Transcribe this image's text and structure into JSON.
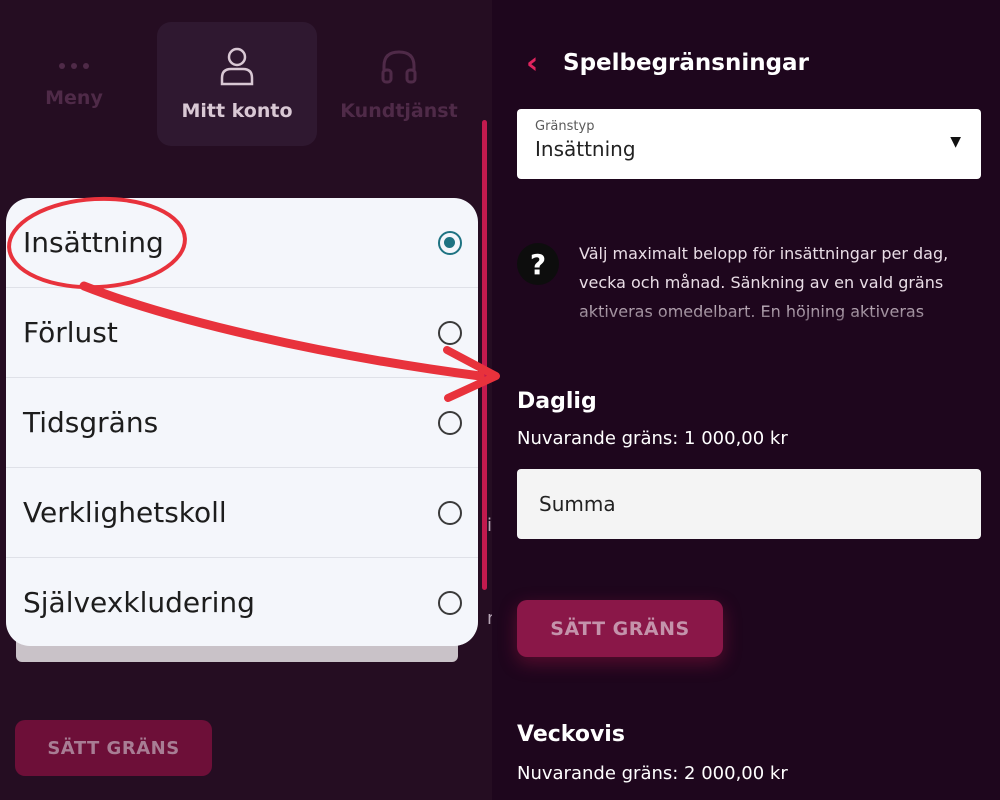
{
  "left": {
    "nav": [
      {
        "label": "Meny",
        "icon": "more-dots-icon"
      },
      {
        "label": "Mitt konto",
        "icon": "person-icon"
      },
      {
        "label": "Kundtjänst",
        "icon": "headset-icon"
      }
    ],
    "stray_1": "i",
    "stray_2": "n",
    "set_limit_label": "SÄTT GRÄNS",
    "options": [
      {
        "label": "Insättning",
        "selected": true
      },
      {
        "label": "Förlust",
        "selected": false
      },
      {
        "label": "Tidsgräns",
        "selected": false
      },
      {
        "label": "Verklighetskoll",
        "selected": false
      },
      {
        "label": "Självexkludering",
        "selected": false
      }
    ]
  },
  "right": {
    "title": "Spelbegränsningar",
    "limit_type": {
      "label": "Gränstyp",
      "value": "Insättning"
    },
    "info_text": "Välj maximalt belopp för insättningar per dag, vecka och månad. Sänkning av en vald gräns aktiveras omedelbart. En höjning aktiveras",
    "daily": {
      "title": "Daglig",
      "current": "Nuvarande gräns: 1 000,00 kr"
    },
    "amount_placeholder": "Summa",
    "set_limit_label": "SÄTT GRÄNS",
    "weekly": {
      "title": "Veckovis",
      "current": "Nuvarande gräns: 2 000,00 kr"
    }
  },
  "colors": {
    "accent": "#e0245e",
    "radio_selected": "#1e7382",
    "annotation": "#e8323c"
  }
}
